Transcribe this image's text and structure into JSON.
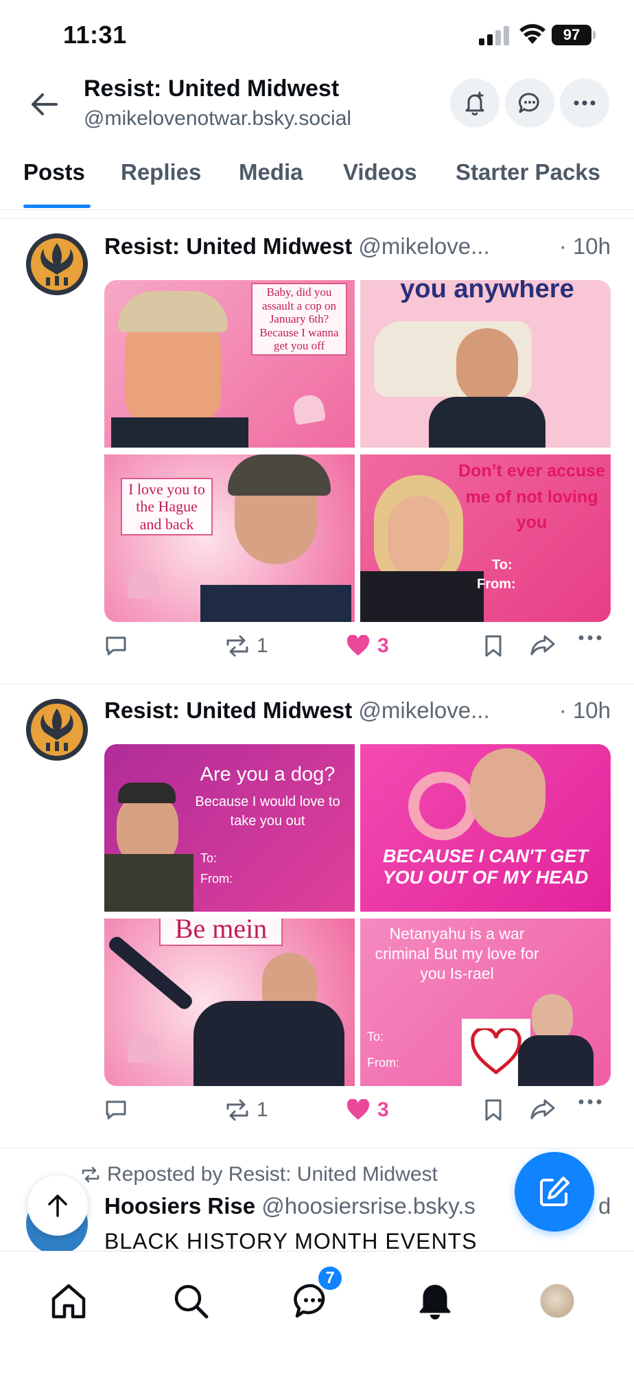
{
  "status": {
    "time": "11:31",
    "battery": "97"
  },
  "header": {
    "title": "Resist: United Midwest",
    "handle": "@mikelovenotwar.bsky.social"
  },
  "tabs": [
    {
      "label": "Posts"
    },
    {
      "label": "Replies"
    },
    {
      "label": "Media"
    },
    {
      "label": "Videos"
    },
    {
      "label": "Starter Packs"
    }
  ],
  "posts": [
    {
      "author": "Resist: United Midwest",
      "handle": "@mikelove...",
      "time": "· 10h",
      "images": {
        "tl": "Baby, did you assault a cop on January 6th? Because I wanna get you off",
        "tr": "you anywhere",
        "bl": "I love you to the Hague and back",
        "br_main": "Don’t ever accuse me of not loving you",
        "br_to": "To:",
        "br_from": "From:"
      },
      "replies": "",
      "reposts": "1",
      "likes": "3"
    },
    {
      "author": "Resist: United Midwest",
      "handle": "@mikelove...",
      "time": "· 10h",
      "images": {
        "tl_title": "Are you a dog?",
        "tl_body": "Because I would love to take you out",
        "tl_to": "To:",
        "tl_from": "From:",
        "tr": "BECAUSE I CAN'T GET YOU OUT OF MY HEAD",
        "bl": "Be mein",
        "br_main": "Netanyahu is a war criminal But my love for you Is-rael",
        "br_to": "To:",
        "br_from": "From:"
      },
      "replies": "",
      "reposts": "1",
      "likes": "3"
    }
  ],
  "repost": {
    "label": "Reposted by Resist: United Midwest",
    "author": "Hoosiers Rise",
    "handle": "@hoosiersrise.bsky.s",
    "handle_tail": "d",
    "text": "BLACK HISTORY MONTH EVENTS"
  },
  "nav": {
    "chat_badge": "7"
  },
  "colors": {
    "accent": "#1083fe",
    "like": "#ec4899"
  }
}
